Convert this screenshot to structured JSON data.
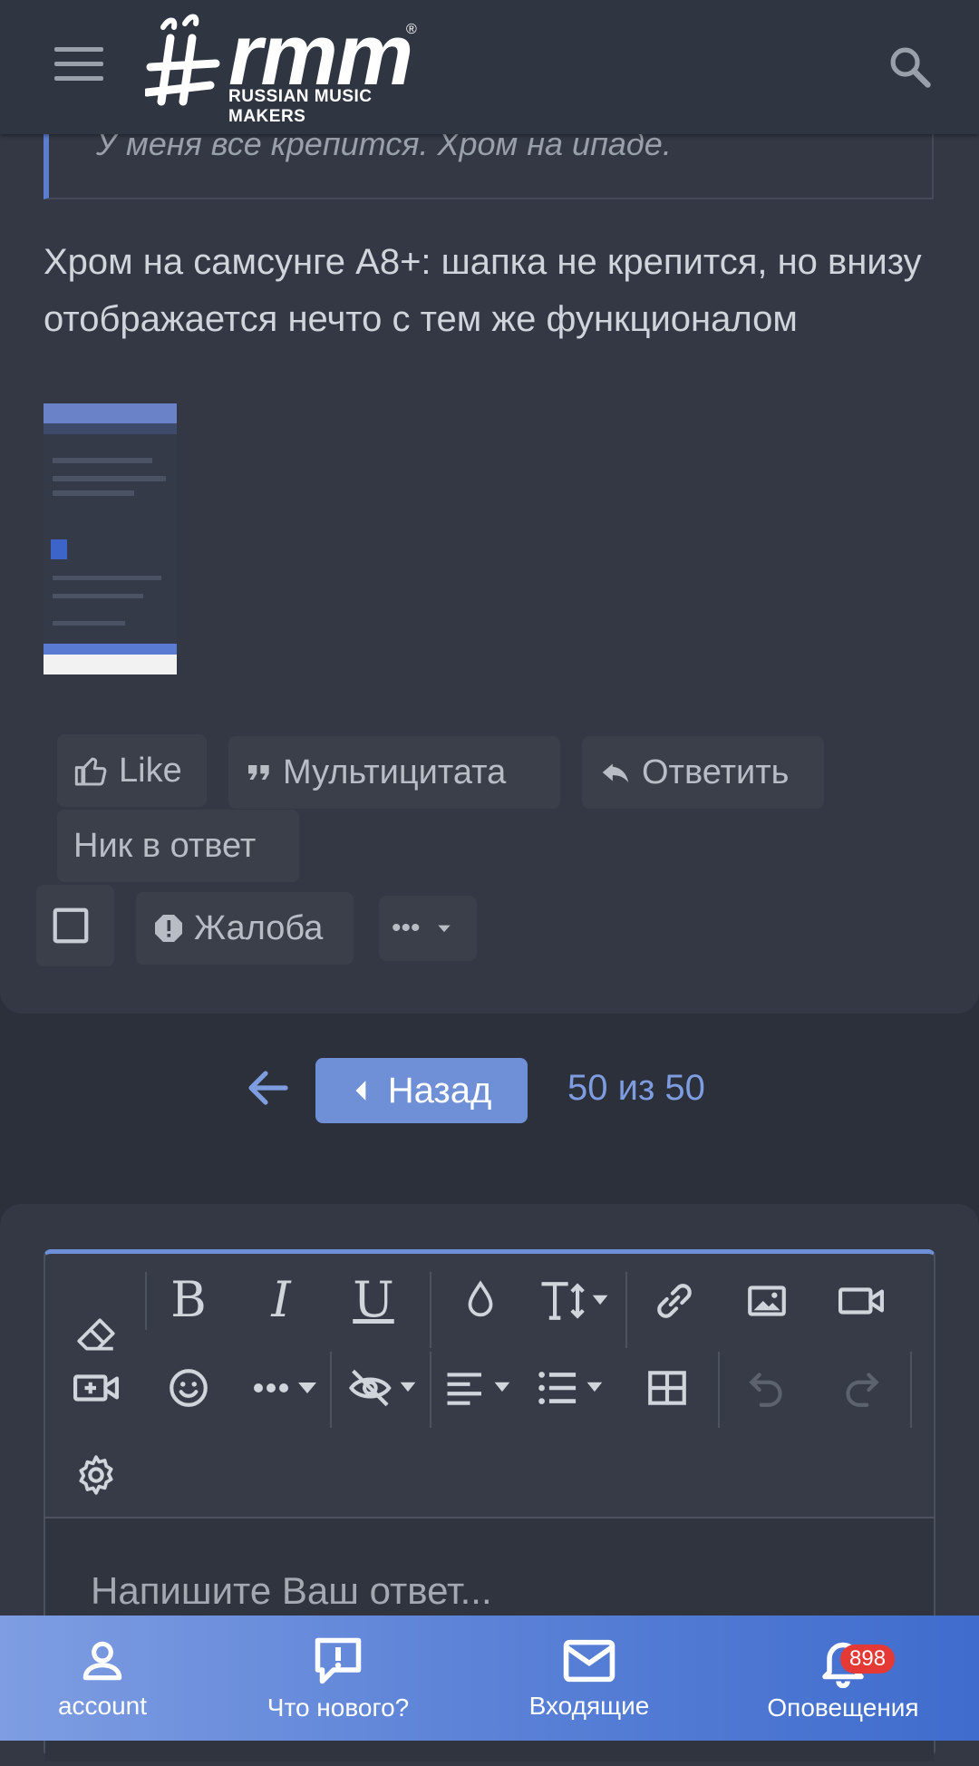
{
  "header": {
    "logo_main": "rmm",
    "logo_sub": "RUSSIAN MUSIC MAKERS",
    "logo_reg": "®"
  },
  "post": {
    "quote_text": "У меня все крепится. Хром на ипаде.",
    "body_text": "Хром на самсунге А8+: шапка не крепится, но внизу отображается нечто с тем же функционалом",
    "actions": {
      "like": "Like",
      "multiquote": "Мультицитата",
      "reply": "Ответить",
      "nick_reply": "Ник в ответ",
      "report": "Жалоба",
      "more": "•••"
    }
  },
  "pagination": {
    "back_label": "Назад",
    "page_status": "50 из 50"
  },
  "editor": {
    "placeholder": "Напишите Ваш ответ...",
    "tools": [
      "eraser-icon",
      "bold-icon",
      "italic-icon",
      "underline-icon",
      "color-drop-icon",
      "text-size-icon",
      "link-icon",
      "image-icon",
      "video-icon",
      "video-add-icon",
      "smiley-icon",
      "more-icon",
      "spoiler-icon",
      "align-icon",
      "list-icon",
      "table-icon",
      "undo-icon",
      "redo-icon",
      "settings-icon"
    ]
  },
  "bottom_nav": {
    "account": "account",
    "whats_new": "Что нового?",
    "inbox": "Входящие",
    "alerts": "Оповещения",
    "alerts_badge": "898"
  },
  "colors": {
    "accent": "#6f8fd6",
    "background": "#2b303b",
    "card": "#333844",
    "badge": "#e53935"
  }
}
